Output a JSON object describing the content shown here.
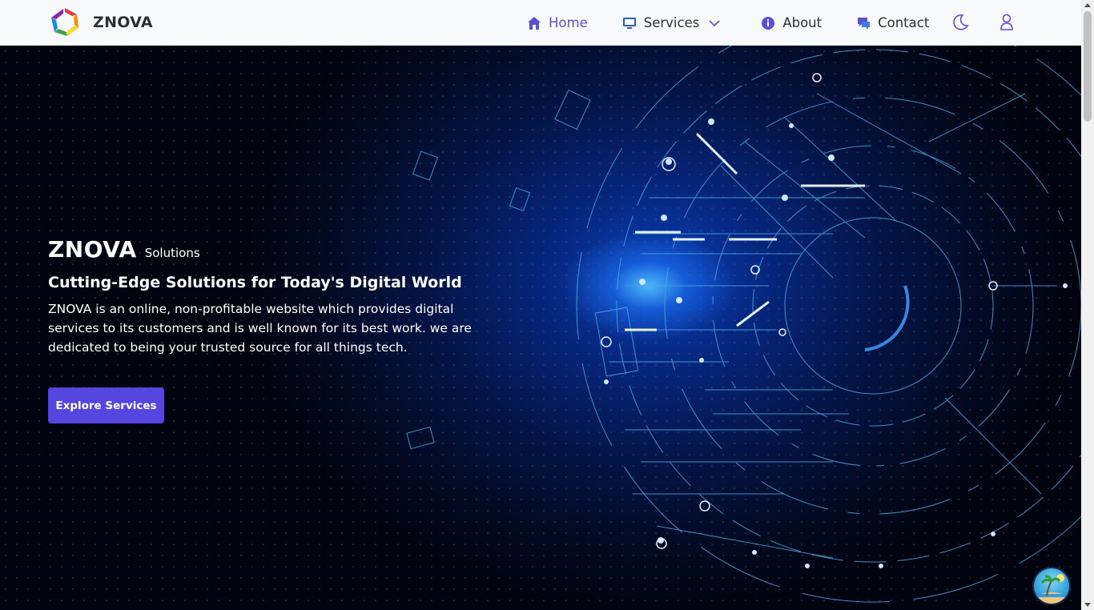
{
  "brand": {
    "name": "ZNOVA"
  },
  "nav": {
    "items": [
      {
        "label": "Home",
        "icon": "home-icon",
        "active": true
      },
      {
        "label": "Services",
        "icon": "monitor-icon"
      },
      {
        "label": "About",
        "icon": "info-icon"
      },
      {
        "label": "Contact",
        "icon": "chat-icon"
      }
    ],
    "theme_toggle_icon": "moon-icon",
    "user_icon": "user-icon"
  },
  "hero": {
    "brand": "ZNOVA",
    "brand_sub": "Solutions",
    "tagline": "Cutting-Edge Solutions for Today's Digital World",
    "description": "ZNOVA is an online, non-profitable website which provides digital services to its customers and is well known for its best work. we are dedicated to being your trusted source for all things tech.",
    "cta_label": "Explore Services"
  },
  "colors": {
    "accent": "#5b4fd8",
    "button": "#5646e0",
    "nav_bg": "#f8f9fb",
    "hero_bg": "#041446"
  }
}
